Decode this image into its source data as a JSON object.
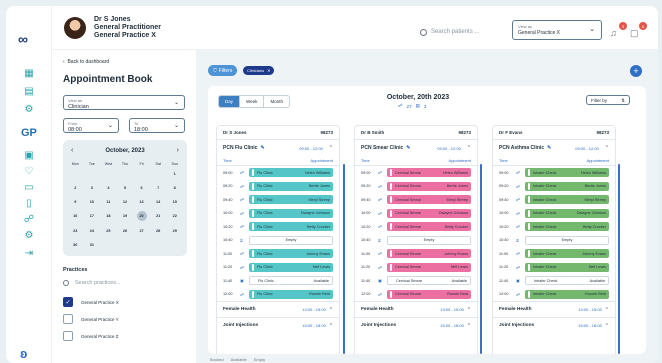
{
  "user": {
    "line1": "Dr S Jones",
    "line2": "General Practitioner",
    "line3": "General Practice X"
  },
  "search": {
    "placeholder": "Search patients ..."
  },
  "view_as": {
    "label": "View as",
    "value": "General Practice X"
  },
  "notifications": {
    "bell": "3",
    "chat": "5"
  },
  "nav": {
    "back": "Back to dashboard",
    "title": "Appointment Book",
    "rail_gp": "GP"
  },
  "filters": {
    "view_as_label": "View as",
    "view_as_value": "Clinician",
    "from_label": "From",
    "from_value": "08:00",
    "to_label": "To",
    "to_value": "18:00"
  },
  "calendar": {
    "month": "October, 2023",
    "days": [
      "Mon",
      "Tue",
      "Wed",
      "Thu",
      "Fri",
      "Sat",
      "Sun"
    ],
    "cells": [
      "",
      "",
      "",
      "",
      "",
      "",
      "1",
      "2",
      "3",
      "4",
      "5",
      "6",
      "7",
      "8",
      "9",
      "10",
      "11",
      "12",
      "13",
      "14",
      "15",
      "16",
      "17",
      "18",
      "19",
      "20",
      "21",
      "22",
      "23",
      "24",
      "25",
      "26",
      "27",
      "28",
      "29",
      "30",
      "31",
      "",
      "",
      "",
      "",
      ""
    ],
    "selected": "20"
  },
  "practices": {
    "title": "Practices",
    "search": "Search practices...",
    "items": [
      "General Practice X",
      "General Practice Y",
      "General Practice Z"
    ]
  },
  "toolbar": {
    "filters": "Filters",
    "chip": "Clinicians",
    "plus": "+"
  },
  "board": {
    "tabs": [
      "Day",
      "Week",
      "Month"
    ],
    "date": "October, 20th 2023",
    "count1": "27",
    "count2": "3",
    "filter_by": "Filter by"
  },
  "columns": [
    {
      "doctor": "Dr S Jones",
      "code": "98273",
      "clinic": "PCN Flu Clinic",
      "time": "09:00 - 12:00",
      "color": "teal",
      "slots": [
        [
          "09:00",
          "Flu Clinic",
          "Helen Williams"
        ],
        [
          "09:20",
          "Flu Clinic",
          "Bertie Jones"
        ],
        [
          "09:40",
          "Flu Clinic",
          "Meryl Streep"
        ],
        [
          "10:00",
          "Flu Clinic",
          "Dwayne Johnson"
        ],
        [
          "10:20",
          "Flu Clinic",
          "Betty Crocker"
        ],
        [
          "10:40",
          "",
          "Empty"
        ],
        [
          "11:00",
          "Flu Clinic",
          "Johnny Evans"
        ],
        [
          "11:20",
          "Flu Clinic",
          "Nell Lewis"
        ],
        [
          "11:40",
          "Flu Clinic",
          "Available"
        ],
        [
          "12:00",
          "Flu Clinic",
          "Ronnie Reid"
        ]
      ],
      "sections": [
        [
          "Female Health",
          "13:00 - 15:00"
        ],
        [
          "Joint Injections",
          "15:00 - 18:00"
        ]
      ]
    },
    {
      "doctor": "Dr B Smith",
      "code": "98273",
      "clinic": "PCN Smear Clinic",
      "time": "09:00 - 12:00",
      "color": "pink",
      "slots": [
        [
          "09:00",
          "Cervical Smear",
          "Helen Williams"
        ],
        [
          "09:20",
          "Cervical Smear",
          "Bertie Jones"
        ],
        [
          "09:40",
          "Cervical Smear",
          "Meryl Streep"
        ],
        [
          "10:00",
          "Cervical Smear",
          "Dwayne Johnson"
        ],
        [
          "10:20",
          "Cervical Smear",
          "Betty Crocker"
        ],
        [
          "10:40",
          "",
          "Empty"
        ],
        [
          "11:00",
          "Cervical Smear",
          "Johnny Evans"
        ],
        [
          "11:20",
          "Cervical Smear",
          "Nell Lewis"
        ],
        [
          "11:40",
          "Cervical Smear",
          "Available"
        ],
        [
          "12:00",
          "Cervical Smear",
          "Ronnie Reid"
        ]
      ],
      "sections": [
        [
          "Female Health",
          "13:00 - 15:00"
        ],
        [
          "Joint Injections",
          "15:00 - 18:00"
        ]
      ]
    },
    {
      "doctor": "Dr F Evans",
      "code": "98273",
      "clinic": "PCN Asthma Clinic",
      "time": "09:00 - 12:00",
      "color": "green",
      "slots": [
        [
          "09:00",
          "Inhaler Check",
          "Helen Williams"
        ],
        [
          "09:20",
          "Inhaler Check",
          "Bertie Jones"
        ],
        [
          "09:40",
          "Inhaler Check",
          "Meryl Streep"
        ],
        [
          "10:00",
          "Inhaler Check",
          "Dwayne Johnson"
        ],
        [
          "10:20",
          "Inhaler Check",
          "Betty Crocker"
        ],
        [
          "10:40",
          "",
          "Empty"
        ],
        [
          "11:00",
          "Inhaler Check",
          "Johnny Evans"
        ],
        [
          "11:20",
          "Inhaler Check",
          "Nell Lewis"
        ],
        [
          "11:40",
          "Inhaler Check",
          "Available"
        ],
        [
          "12:00",
          "Inhaler Check",
          "Ronnie Reid"
        ]
      ],
      "sections": [
        [
          "Female Health",
          "13:00 - 15:00"
        ],
        [
          "Joint Injections",
          "15:00 - 18:00"
        ]
      ]
    }
  ],
  "table_head": {
    "time": "Time",
    "appt": "Appointment"
  },
  "legend": [
    "Booked",
    "Available",
    "Empty"
  ]
}
